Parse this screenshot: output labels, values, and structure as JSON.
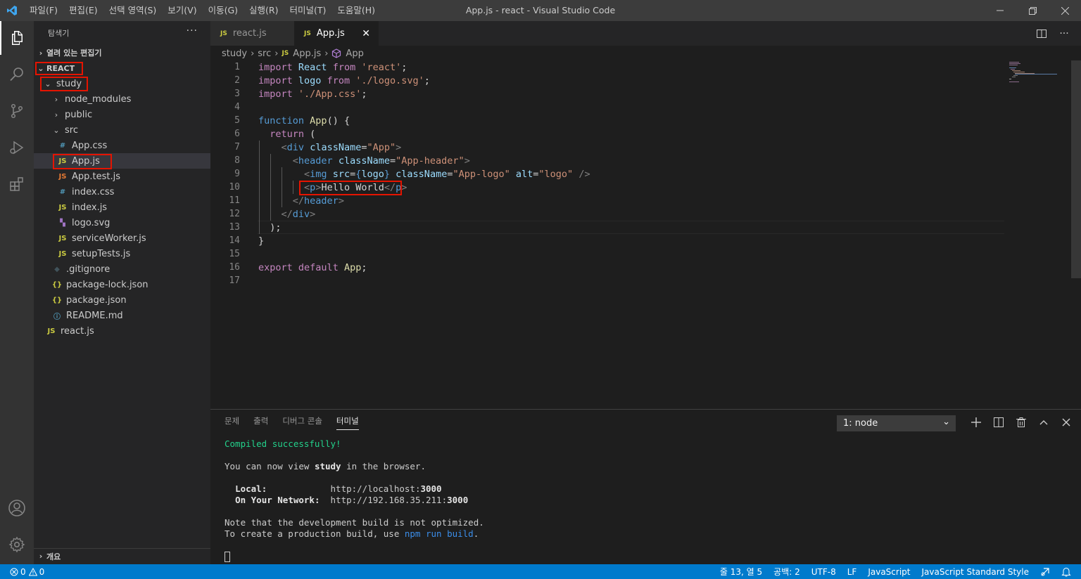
{
  "window": {
    "title": "App.js - react - Visual Studio Code",
    "menu": [
      "파일(F)",
      "편집(E)",
      "선택 영역(S)",
      "보기(V)",
      "이동(G)",
      "실행(R)",
      "터미널(T)",
      "도움말(H)"
    ]
  },
  "sidebar": {
    "title": "탐색기",
    "open_editors": "열려 있는 편집기",
    "workspace": "REACT",
    "outline": "개요",
    "tree": [
      {
        "label": "study",
        "icon": "",
        "icon_color": "",
        "type": "folder-open"
      },
      {
        "label": "node_modules",
        "icon": "",
        "icon_color": "",
        "type": "folder"
      },
      {
        "label": "public",
        "icon": "",
        "icon_color": "",
        "type": "folder"
      },
      {
        "label": "src",
        "icon": "",
        "icon_color": "",
        "type": "folder-open"
      },
      {
        "label": "App.css",
        "icon": "#",
        "icon_color": "#519aba",
        "type": "file"
      },
      {
        "label": "App.js",
        "icon": "JS",
        "icon_color": "#cbcb41",
        "type": "file"
      },
      {
        "label": "App.test.js",
        "icon": "JS",
        "icon_color": "#e37933",
        "type": "file"
      },
      {
        "label": "index.css",
        "icon": "#",
        "icon_color": "#519aba",
        "type": "file"
      },
      {
        "label": "index.js",
        "icon": "JS",
        "icon_color": "#cbcb41",
        "type": "file"
      },
      {
        "label": "logo.svg",
        "icon": "▚",
        "icon_color": "#a074c4",
        "type": "file"
      },
      {
        "label": "serviceWorker.js",
        "icon": "JS",
        "icon_color": "#cbcb41",
        "type": "file"
      },
      {
        "label": "setupTests.js",
        "icon": "JS",
        "icon_color": "#cbcb41",
        "type": "file"
      },
      {
        "label": ".gitignore",
        "icon": "◆",
        "icon_color": "#41535b",
        "type": "file"
      },
      {
        "label": "package-lock.json",
        "icon": "{}",
        "icon_color": "#cbcb41",
        "type": "file"
      },
      {
        "label": "package.json",
        "icon": "{}",
        "icon_color": "#cbcb41",
        "type": "file"
      },
      {
        "label": "README.md",
        "icon": "ⓘ",
        "icon_color": "#519aba",
        "type": "file"
      },
      {
        "label": "react.js",
        "icon": "JS",
        "icon_color": "#cbcb41",
        "type": "file"
      }
    ]
  },
  "tabs": [
    {
      "label": "react.js",
      "icon": "JS"
    },
    {
      "label": "App.js",
      "icon": "JS",
      "close": "✕"
    }
  ],
  "breadcrumb": {
    "study": "study",
    "src": "src",
    "file": "App.js",
    "symbol": "App"
  },
  "editor": {
    "line_numbers": [
      "1",
      "2",
      "3",
      "4",
      "5",
      "6",
      "7",
      "8",
      "9",
      "10",
      "11",
      "12",
      "13",
      "14",
      "15",
      "16",
      "17"
    ],
    "lines": [
      [
        {
          "t": "import",
          "c": "kw"
        },
        {
          "t": " ",
          "c": "plain"
        },
        {
          "t": "React",
          "c": "var"
        },
        {
          "t": " ",
          "c": "plain"
        },
        {
          "t": "from",
          "c": "kw"
        },
        {
          "t": " ",
          "c": "plain"
        },
        {
          "t": "'react'",
          "c": "str"
        },
        {
          "t": ";",
          "c": "plain"
        }
      ],
      [
        {
          "t": "import",
          "c": "kw"
        },
        {
          "t": " ",
          "c": "plain"
        },
        {
          "t": "logo",
          "c": "var"
        },
        {
          "t": " ",
          "c": "plain"
        },
        {
          "t": "from",
          "c": "kw"
        },
        {
          "t": " ",
          "c": "plain"
        },
        {
          "t": "'./logo.svg'",
          "c": "str"
        },
        {
          "t": ";",
          "c": "plain"
        }
      ],
      [
        {
          "t": "import",
          "c": "kw"
        },
        {
          "t": " ",
          "c": "plain"
        },
        {
          "t": "'./App.css'",
          "c": "str"
        },
        {
          "t": ";",
          "c": "plain"
        }
      ],
      [],
      [
        {
          "t": "function",
          "c": "kw2"
        },
        {
          "t": " ",
          "c": "plain"
        },
        {
          "t": "App",
          "c": "fn"
        },
        {
          "t": "() {",
          "c": "plain"
        }
      ],
      [
        {
          "t": "  ",
          "c": "plain"
        },
        {
          "t": "return",
          "c": "kw"
        },
        {
          "t": " (",
          "c": "plain"
        }
      ],
      [
        {
          "t": "    ",
          "c": "plain"
        },
        {
          "t": "<",
          "c": "tagb"
        },
        {
          "t": "div",
          "c": "tag"
        },
        {
          "t": " ",
          "c": "plain"
        },
        {
          "t": "className",
          "c": "attr"
        },
        {
          "t": "=",
          "c": "plain"
        },
        {
          "t": "\"App\"",
          "c": "str"
        },
        {
          "t": ">",
          "c": "tagb"
        }
      ],
      [
        {
          "t": "      ",
          "c": "plain"
        },
        {
          "t": "<",
          "c": "tagb"
        },
        {
          "t": "header",
          "c": "tag"
        },
        {
          "t": " ",
          "c": "plain"
        },
        {
          "t": "className",
          "c": "attr"
        },
        {
          "t": "=",
          "c": "plain"
        },
        {
          "t": "\"App-header\"",
          "c": "str"
        },
        {
          "t": ">",
          "c": "tagb"
        }
      ],
      [
        {
          "t": "        ",
          "c": "plain"
        },
        {
          "t": "<",
          "c": "tagb"
        },
        {
          "t": "img",
          "c": "tag"
        },
        {
          "t": " ",
          "c": "plain"
        },
        {
          "t": "src",
          "c": "attr"
        },
        {
          "t": "=",
          "c": "plain"
        },
        {
          "t": "{",
          "c": "kw2"
        },
        {
          "t": "logo",
          "c": "var"
        },
        {
          "t": "}",
          "c": "kw2"
        },
        {
          "t": " ",
          "c": "plain"
        },
        {
          "t": "className",
          "c": "attr"
        },
        {
          "t": "=",
          "c": "plain"
        },
        {
          "t": "\"App-logo\"",
          "c": "str"
        },
        {
          "t": " ",
          "c": "plain"
        },
        {
          "t": "alt",
          "c": "attr"
        },
        {
          "t": "=",
          "c": "plain"
        },
        {
          "t": "\"logo\"",
          "c": "str"
        },
        {
          "t": " />",
          "c": "tagb"
        }
      ],
      [
        {
          "t": "        ",
          "c": "plain"
        },
        {
          "t": "<",
          "c": "tagb"
        },
        {
          "t": "p",
          "c": "tag"
        },
        {
          "t": ">",
          "c": "tagb"
        },
        {
          "t": "Hello World",
          "c": "plain"
        },
        {
          "t": "</",
          "c": "tagb"
        },
        {
          "t": "p",
          "c": "tag"
        },
        {
          "t": ">",
          "c": "tagb"
        }
      ],
      [
        {
          "t": "      ",
          "c": "plain"
        },
        {
          "t": "</",
          "c": "tagb"
        },
        {
          "t": "header",
          "c": "tag"
        },
        {
          "t": ">",
          "c": "tagb"
        }
      ],
      [
        {
          "t": "    ",
          "c": "plain"
        },
        {
          "t": "</",
          "c": "tagb"
        },
        {
          "t": "div",
          "c": "tag"
        },
        {
          "t": ">",
          "c": "tagb"
        }
      ],
      [
        {
          "t": "  );",
          "c": "plain"
        }
      ],
      [
        {
          "t": "}",
          "c": "plain"
        }
      ],
      [],
      [
        {
          "t": "export",
          "c": "kw"
        },
        {
          "t": " ",
          "c": "plain"
        },
        {
          "t": "default",
          "c": "kw"
        },
        {
          "t": " ",
          "c": "plain"
        },
        {
          "t": "App",
          "c": "fn"
        },
        {
          "t": ";",
          "c": "plain"
        }
      ],
      []
    ]
  },
  "panel": {
    "tabs": [
      "문제",
      "출력",
      "디버그 콘솔",
      "터미널"
    ],
    "active_tab": "터미널",
    "terminal_select": "1: node",
    "terminal": {
      "compiled": "Compiled successfully!",
      "view_prefix": "You can now view ",
      "view_app": "study",
      "view_suffix": " in the browser.",
      "local_label": "Local:",
      "local_url": "http://localhost:",
      "local_port": "3000",
      "network_label": "On Your Network:",
      "network_url": "http://192.168.35.211:",
      "network_port": "3000",
      "note": "Note that the development build is not optimized.",
      "build_prefix": "To create a production build, use ",
      "build_cmd": "npm run build",
      "build_suffix": "."
    }
  },
  "statusbar": {
    "errors": "0",
    "warnings": "0",
    "position": "줄 13, 열 5",
    "spaces": "공백: 2",
    "encoding": "UTF-8",
    "eol": "LF",
    "language": "JavaScript",
    "linter": "JavaScript Standard Style"
  },
  "colors": {
    "accent": "#007acc",
    "highlight_box": "#e51400",
    "activity_bar": "#333333",
    "sidebar": "#252526",
    "editor": "#1e1e1e"
  }
}
